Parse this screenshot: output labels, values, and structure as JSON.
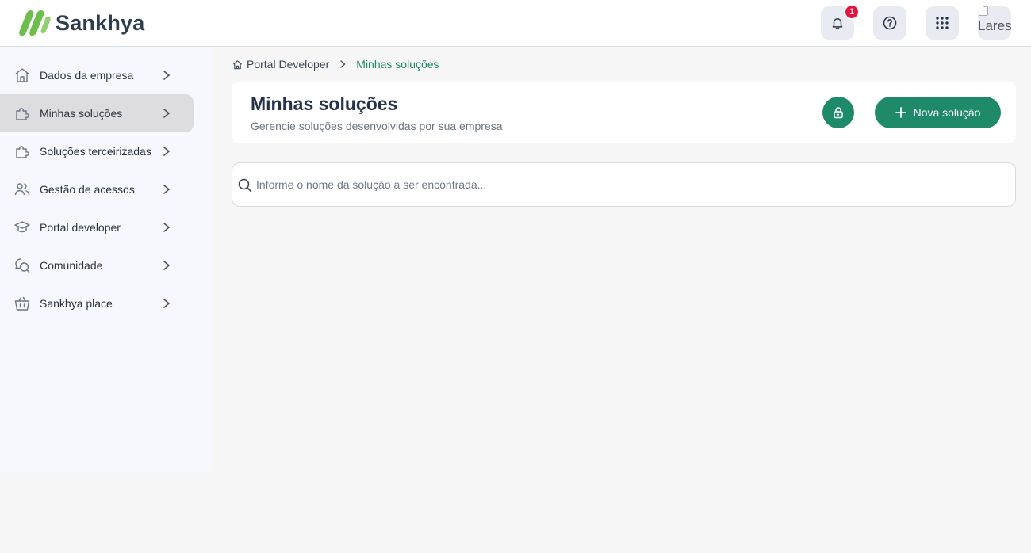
{
  "header": {
    "logo_text": "Sankhya",
    "logo_colors": [
      "#6cc04a",
      "#2f3e4e"
    ],
    "notifications": {
      "icon": "bell-icon",
      "count": "1"
    },
    "help_icon": "help-circle-icon",
    "apps_icon": "grid-dots-icon",
    "avatar_alt": "Lares"
  },
  "sidebar": {
    "items": [
      {
        "label": "Dados da empresa",
        "icon": "building-icon",
        "active": false
      },
      {
        "label": "Minhas soluções",
        "icon": "puzzle-icon",
        "active": true
      },
      {
        "label": "Soluções terceirizadas",
        "icon": "puzzle-icon",
        "active": false
      },
      {
        "label": "Gestão de acessos",
        "icon": "users-icon",
        "active": false
      },
      {
        "label": "Portal developer",
        "icon": "graduation-cap-icon",
        "active": false
      },
      {
        "label": "Comunidade",
        "icon": "chat-bubbles-icon",
        "active": false
      },
      {
        "label": "Sankhya place",
        "icon": "basket-icon",
        "active": false
      }
    ]
  },
  "breadcrumb": {
    "root": "Portal Developer",
    "current": "Minhas soluções"
  },
  "page": {
    "title": "Minhas soluções",
    "subtitle": "Gerencie soluções desenvolvidas por sua empresa",
    "new_button_label": "Nova solução"
  },
  "search": {
    "placeholder": "Informe o nome da solução a ser encontrada...",
    "value": ""
  },
  "colors": {
    "accent": "#1e8a6a",
    "badge": "#e8123d",
    "active_item_bg": "#dddddf"
  }
}
